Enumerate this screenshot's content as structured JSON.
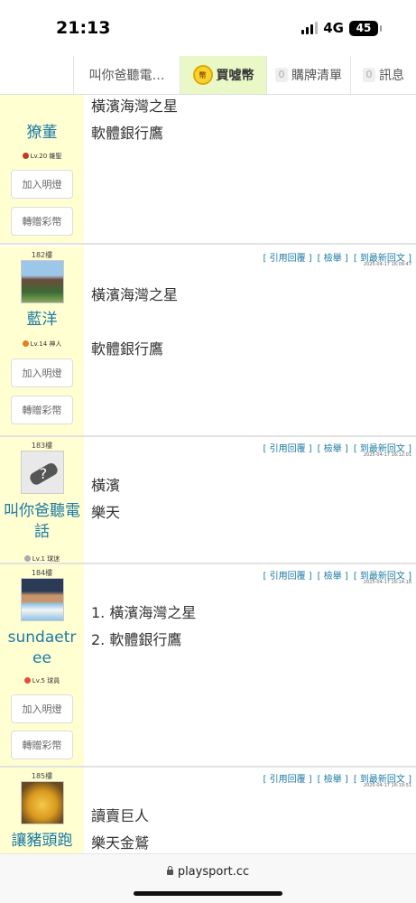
{
  "status": {
    "time": "21:13",
    "network": "4G",
    "battery": "45"
  },
  "nav": {
    "title": "叫你爸聽電…",
    "buy_coin": "買噓幣",
    "buy_coin_icon": "coin-icon",
    "cart_count": "0",
    "cart": "購牌清單",
    "msg_count": "0",
    "messages": "訊息"
  },
  "posts": [
    {
      "floor": "",
      "username": "獠董",
      "level": "Lv.20 雜聖",
      "level_color": "#c0392b",
      "btn_light": "加入明燈",
      "btn_gift": "轉贈彩幣",
      "actions": [],
      "time": "",
      "lines": [
        "橫濱海灣之星",
        "軟體銀行鷹"
      ]
    },
    {
      "floor": "182樓",
      "username": "藍洋",
      "level": "Lv.14 神人",
      "level_color": "#e67e22",
      "btn_light": "加入明燈",
      "btn_gift": "轉贈彩幣",
      "actions": [
        "[ 引用回覆 ]",
        "[ 檢舉 ]",
        "[ 到最新回文 ]"
      ],
      "time": "2025-04-17 16:09:47",
      "lines": [
        "橫濱海灣之星",
        "軟體銀行鷹"
      ]
    },
    {
      "floor": "183樓",
      "username": "叫你爸聽電話",
      "level": "Lv.1 球迷",
      "level_color": "#888888",
      "actions": [
        "[ 引用回覆 ]",
        "[ 檢舉 ]",
        "[ 到最新回文 ]"
      ],
      "time": "2025-04-17 16:12:01",
      "lines": [
        "橫濱",
        "樂天"
      ]
    },
    {
      "floor": "184樓",
      "username": "sundaetree",
      "level": "Lv.5 球員",
      "level_color": "#e74c3c",
      "btn_light": "加入明燈",
      "btn_gift": "轉贈彩幣",
      "actions": [
        "[ 引用回覆 ]",
        "[ 檢舉 ]",
        "[ 到最新回文 ]"
      ],
      "time": "2025-04-17 16:14:18",
      "lines": [
        "1. 橫濱海灣之星",
        "2. 軟體銀行鷹"
      ]
    },
    {
      "floor": "185樓",
      "username": "讓豬頭跑",
      "actions": [
        "[ 引用回覆 ]",
        "[ 檢舉 ]",
        "[ 到最新回文 ]"
      ],
      "time": "2025-04-17 16:19:51",
      "lines": [
        "讀賣巨人",
        "樂天金鷲"
      ]
    }
  ],
  "browser": {
    "url": "playsport.cc"
  }
}
